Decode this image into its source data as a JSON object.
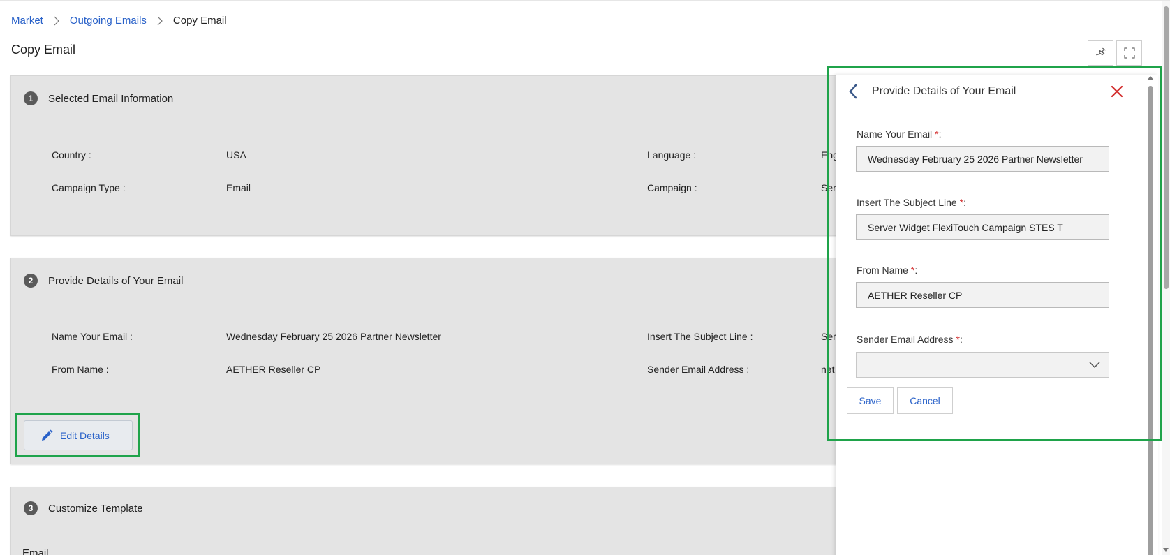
{
  "breadcrumb": {
    "items": [
      "Market",
      "Outgoing Emails"
    ],
    "current": "Copy Email"
  },
  "page_title": "Copy Email",
  "section1": {
    "number": "1",
    "title": "Selected Email Information",
    "fields": [
      {
        "label": "Country :",
        "value": "USA"
      },
      {
        "label": "Language :",
        "value": "Eng"
      },
      {
        "label": "Campaign Type :",
        "value": "Email"
      },
      {
        "label": "Campaign :",
        "value": "Ser"
      }
    ]
  },
  "section2": {
    "number": "2",
    "title": "Provide Details of Your Email",
    "fields": [
      {
        "label": "Name Your Email :",
        "value": "Wednesday February 25 2026 Partner Newsletter"
      },
      {
        "label": "Insert The Subject Line :",
        "value": "Ser"
      },
      {
        "label": "From Name :",
        "value": "AETHER Reseller CP"
      },
      {
        "label": "Sender Email Address :",
        "value": "net"
      }
    ],
    "edit_label": "Edit Details"
  },
  "section3": {
    "number": "3",
    "title": "Customize Template",
    "sub": "Email"
  },
  "panel": {
    "title": "Provide Details of Your Email",
    "required_mark": "*",
    "fields": [
      {
        "label": "Name Your Email",
        "suffix": ":",
        "value": "Wednesday February 25 2026 Partner Newsletter"
      },
      {
        "label": "Insert The Subject Line",
        "suffix": ":",
        "value": "Server Widget FlexiTouch Campaign STES T"
      },
      {
        "label": "From Name",
        "suffix": ":",
        "value": "AETHER Reseller CP"
      },
      {
        "label": "Sender Email Address",
        "suffix": ":",
        "value": ""
      }
    ],
    "save_label": "Save",
    "cancel_label": "Cancel"
  },
  "colors": {
    "accent": "#2a62c9",
    "highlight": "#1fa34a",
    "close": "#d32f2f",
    "card_bg": "#e4e4e4"
  },
  "icons": [
    "chevron-right-icon",
    "pin-icon",
    "fullscreen-icon",
    "back-arrow-icon",
    "close-icon",
    "pencil-icon",
    "chevron-down-icon"
  ]
}
